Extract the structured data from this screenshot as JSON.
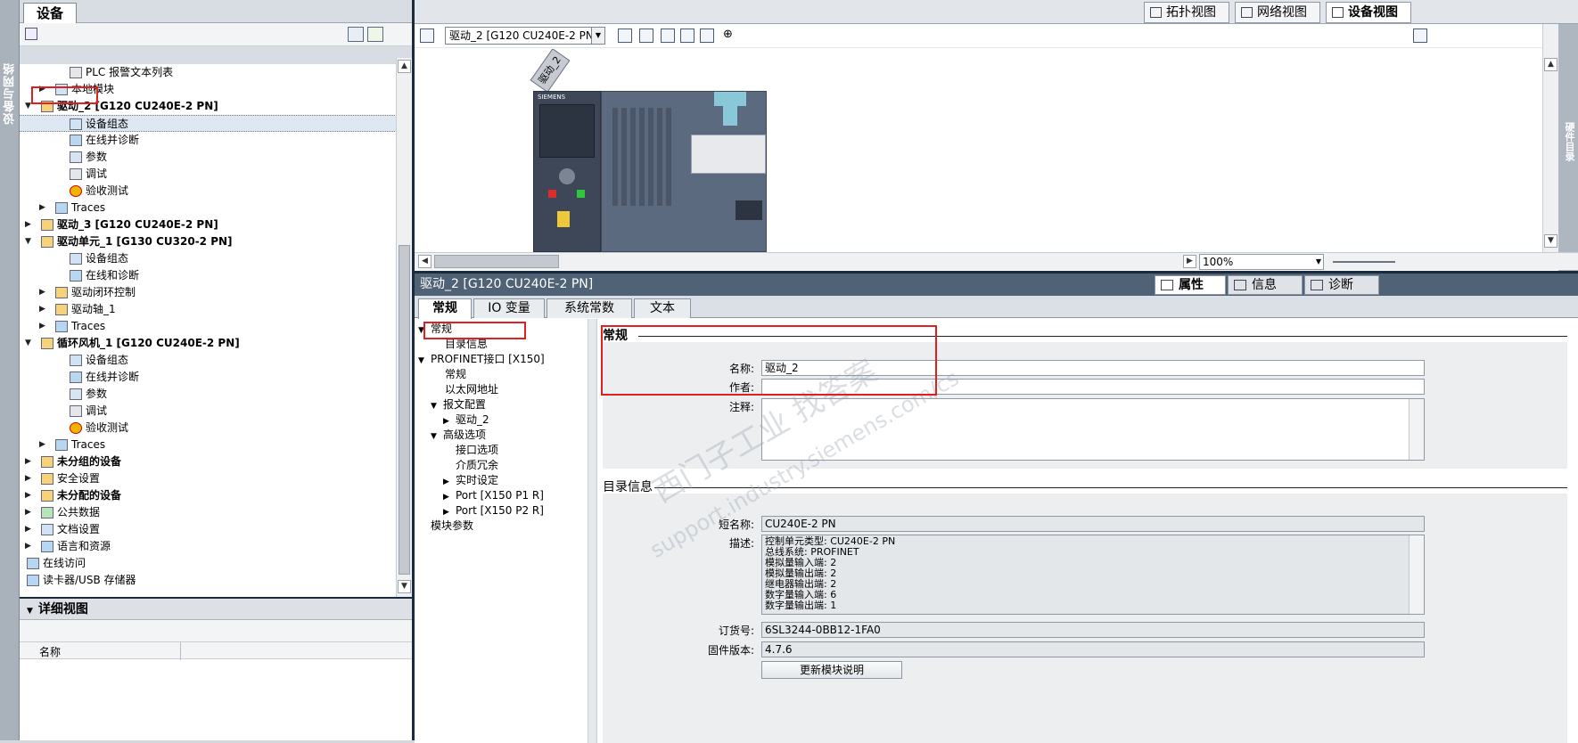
{
  "left_strip": {
    "label": "设备与网络"
  },
  "tree": {
    "tab": "设备",
    "items": [
      {
        "label": "PLC 报警文本列表",
        "arrow": "",
        "bold": false
      },
      {
        "label": "本地模块",
        "arrow": "▶",
        "bold": false
      },
      {
        "label": "驱动_2 [G120 CU240E-2 PN]",
        "arrow": "▼",
        "bold": true
      },
      {
        "label": "设备组态",
        "arrow": "",
        "bold": false
      },
      {
        "label": "在线并诊断",
        "arrow": "",
        "bold": false
      },
      {
        "label": "参数",
        "arrow": "",
        "bold": false
      },
      {
        "label": "调试",
        "arrow": "",
        "bold": false
      },
      {
        "label": "验收测试",
        "arrow": "",
        "bold": false
      },
      {
        "label": "Traces",
        "arrow": "▶",
        "bold": false
      },
      {
        "label": "驱动_3 [G120 CU240E-2 PN]",
        "arrow": "▶",
        "bold": true
      },
      {
        "label": "驱动单元_1 [G130 CU320-2 PN]",
        "arrow": "▼",
        "bold": true
      },
      {
        "label": "设备组态",
        "arrow": "",
        "bold": false
      },
      {
        "label": "在线和诊断",
        "arrow": "",
        "bold": false
      },
      {
        "label": "驱动闭环控制",
        "arrow": "▶",
        "bold": false
      },
      {
        "label": "驱动轴_1",
        "arrow": "▶",
        "bold": false
      },
      {
        "label": "Traces",
        "arrow": "▶",
        "bold": false
      },
      {
        "label": "循环风机_1 [G120 CU240E-2 PN]",
        "arrow": "▼",
        "bold": true
      },
      {
        "label": "设备组态",
        "arrow": "",
        "bold": false
      },
      {
        "label": "在线并诊断",
        "arrow": "",
        "bold": false
      },
      {
        "label": "参数",
        "arrow": "",
        "bold": false
      },
      {
        "label": "调试",
        "arrow": "",
        "bold": false
      },
      {
        "label": "验收测试",
        "arrow": "",
        "bold": false
      },
      {
        "label": "Traces",
        "arrow": "▶",
        "bold": false
      },
      {
        "label": "未分组的设备",
        "arrow": "▶",
        "bold": true
      },
      {
        "label": "安全设置",
        "arrow": "▶",
        "bold": false
      },
      {
        "label": "未分配的设备",
        "arrow": "▶",
        "bold": true
      },
      {
        "label": "公共数据",
        "arrow": "▶",
        "bold": false
      },
      {
        "label": "文档设置",
        "arrow": "▶",
        "bold": false
      },
      {
        "label": "语言和资源",
        "arrow": "▶",
        "bold": false
      },
      {
        "label": "在线访问",
        "arrow": "▶",
        "bold": false
      },
      {
        "label": "读卡器/USB 存储器",
        "arrow": "▶",
        "bold": false
      }
    ]
  },
  "details": {
    "title": "详细视图",
    "column_name": "名称"
  },
  "device_view": {
    "tabs": [
      "拓扑视图",
      "网络视图",
      "设备视图"
    ],
    "active_tab": "设备视图",
    "device_select": "驱动_2 [G120 CU240E-2 PN]",
    "device_tag": "驱动_2",
    "brand": "SIEMENS",
    "zoom": "100%",
    "right_strip": "硬件目录"
  },
  "inspector": {
    "title": "驱动_2 [G120 CU240E-2 PN]",
    "header_tabs": [
      "属性",
      "信息",
      "诊断"
    ],
    "prop_tabs": [
      "常规",
      "IO 变量",
      "系统常数",
      "文本"
    ],
    "nav": [
      {
        "label": "常规",
        "arrow": "▼"
      },
      {
        "label": "目录信息",
        "arrow": ""
      },
      {
        "label": "PROFINET接口 [X150]",
        "arrow": "▼"
      },
      {
        "label": "常规",
        "arrow": ""
      },
      {
        "label": "以太网地址",
        "arrow": ""
      },
      {
        "label": "报文配置",
        "arrow": "▼"
      },
      {
        "label": "驱动_2",
        "arrow": "▶"
      },
      {
        "label": "高级选项",
        "arrow": "▼"
      },
      {
        "label": "接口选项",
        "arrow": ""
      },
      {
        "label": "介质冗余",
        "arrow": ""
      },
      {
        "label": "实时设定",
        "arrow": "▶"
      },
      {
        "label": "Port [X150 P1 R]",
        "arrow": "▶"
      },
      {
        "label": "Port [X150 P2 R]",
        "arrow": "▶"
      },
      {
        "label": "模块参数",
        "arrow": ""
      }
    ],
    "general": {
      "heading": "常规",
      "name_label": "名称:",
      "name_value": "驱动_2",
      "author_label": "作者:",
      "author_value": "",
      "comment_label": "注释:",
      "comment_value": ""
    },
    "catalog": {
      "heading": "目录信息",
      "short_label": "短名称:",
      "short_value": "CU240E-2 PN",
      "desc_label": "描述:",
      "desc_lines": [
        "控制单元类型: CU240E-2 PN",
        "总线系统: PROFINET",
        "模拟量输入端: 2",
        "模拟量输出端: 2",
        "继电器输出端: 2",
        "数字量输入端: 6",
        "数字量输出端: 1"
      ],
      "order_label": "订货号:",
      "order_value": "6SL3244-0BB12-1FA0",
      "fw_label": "固件版本:",
      "fw_value": "4.7.6",
      "update_button": "更新模块说明"
    }
  },
  "watermark": {
    "line1": "西门子工业   找答案",
    "line2": "support.industry.siemens.com/cs"
  },
  "colors": {
    "highlight_red": "#e02020",
    "title_bar": "#4f6276",
    "device_body": "#5b6a7e"
  }
}
